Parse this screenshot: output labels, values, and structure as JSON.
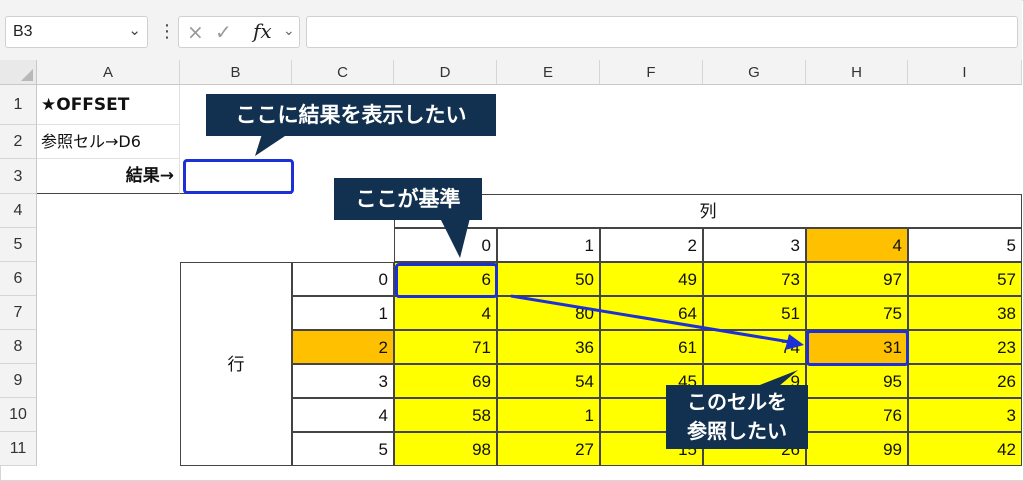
{
  "name_box": "B3",
  "formula_bar": {
    "cancel_icon": "×",
    "enter_icon": "✓",
    "fx": "fx",
    "formula": ""
  },
  "columns": [
    "A",
    "B",
    "C",
    "D",
    "E",
    "F",
    "G",
    "H",
    "I"
  ],
  "rows": [
    "1",
    "2",
    "3",
    "4",
    "5",
    "6",
    "7",
    "8",
    "9",
    "10",
    "11"
  ],
  "cells": {
    "A1": "★OFFSET",
    "A2": "参照セル→D6",
    "A3": "結果→",
    "col_header_label": "列",
    "row_header_label": "行",
    "col_offsets": [
      "0",
      "1",
      "2",
      "3",
      "4",
      "5"
    ],
    "row_offsets": [
      "0",
      "1",
      "2",
      "3",
      "4",
      "5"
    ],
    "table": [
      [
        "6",
        "50",
        "49",
        "73",
        "97",
        "57"
      ],
      [
        "4",
        "80",
        "64",
        "51",
        "75",
        "38"
      ],
      [
        "71",
        "36",
        "61",
        "74",
        "31",
        "23"
      ],
      [
        "69",
        "54",
        "45",
        "9",
        "95",
        "26"
      ],
      [
        "58",
        "1",
        "",
        "",
        "76",
        "3"
      ],
      [
        "98",
        "27",
        "15",
        "26",
        "99",
        "42"
      ]
    ]
  },
  "callouts": {
    "result": "ここに結果を表示したい",
    "base": "ここが基準",
    "target_line1": "このセルを",
    "target_line2": "参照したい"
  },
  "colors": {
    "yellow": "#ffff00",
    "orange": "#ffc000",
    "callout": "#12304f",
    "highlight": "#1d2fd6"
  }
}
